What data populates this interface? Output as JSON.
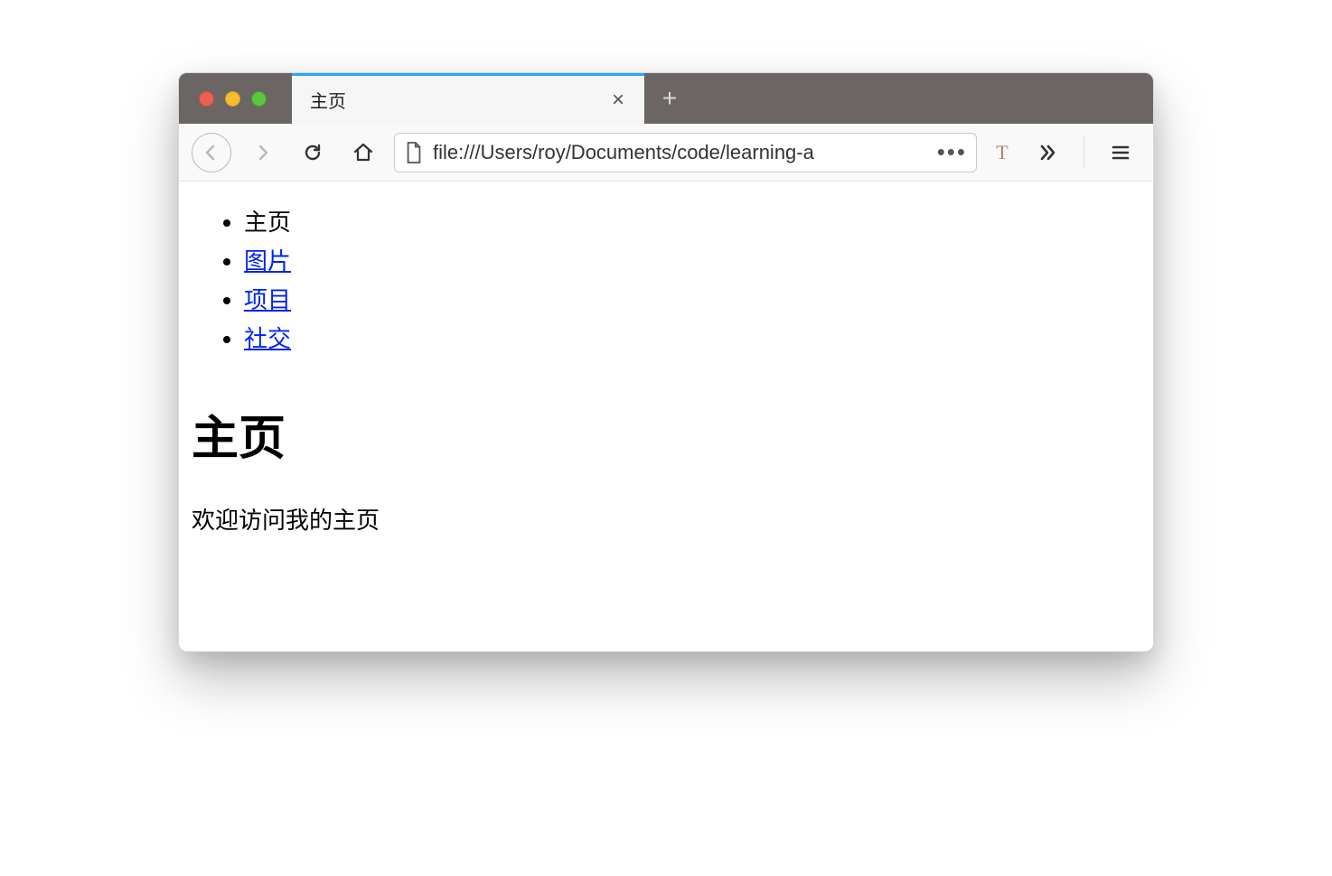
{
  "tab": {
    "title": "主页"
  },
  "urlbar": {
    "url": "file:///Users/roy/Documents/code/learning-a"
  },
  "extension": {
    "label": "T"
  },
  "nav": {
    "items": [
      {
        "label": "主页",
        "current": true
      },
      {
        "label": "图片",
        "current": false
      },
      {
        "label": "项目",
        "current": false
      },
      {
        "label": "社交",
        "current": false
      }
    ]
  },
  "content": {
    "heading": "主页",
    "welcome": "欢迎访问我的主页"
  }
}
